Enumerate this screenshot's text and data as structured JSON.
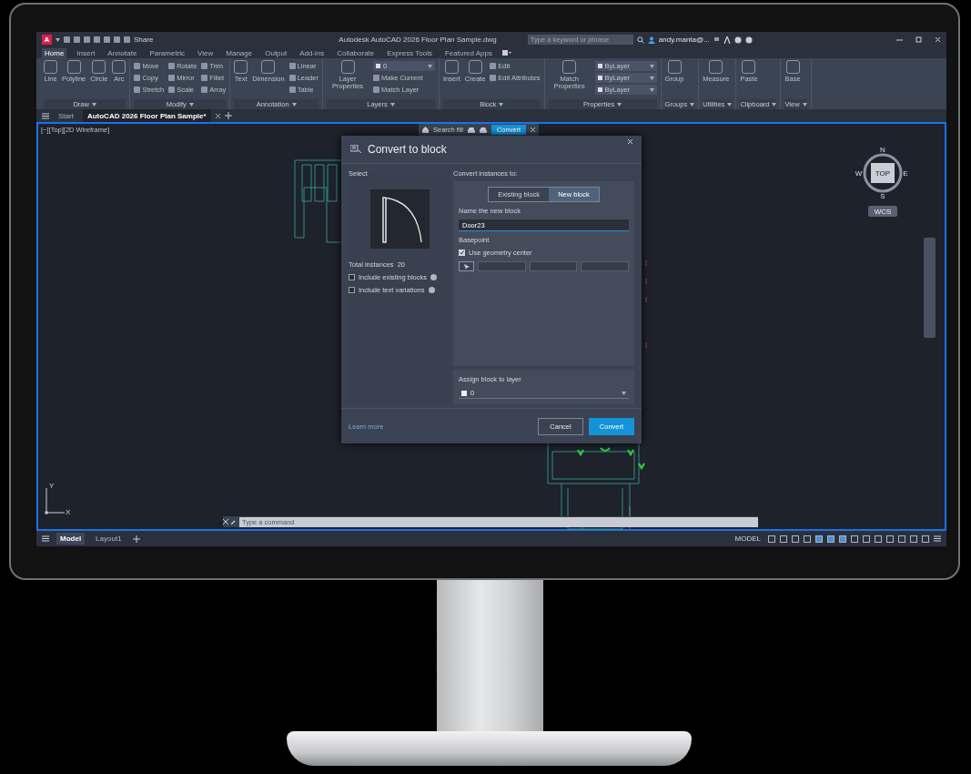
{
  "title_bar": {
    "app_logo": "A",
    "share": "Share",
    "title": "Autodesk AutoCAD 2026  Floor Plan Sample.dwg",
    "search": {
      "placeholder": "Type a keyword or phrase"
    },
    "user": "andy.manta@..."
  },
  "ribbon": {
    "tabs": [
      {
        "label": "Home",
        "selected": true
      },
      {
        "label": "Insert",
        "selected": false
      },
      {
        "label": "Annotate",
        "selected": false
      },
      {
        "label": "Parametric",
        "selected": false
      },
      {
        "label": "View",
        "selected": false
      },
      {
        "label": "Manage",
        "selected": false
      },
      {
        "label": "Output",
        "selected": false
      },
      {
        "label": "Add-ins",
        "selected": false
      },
      {
        "label": "Collaborate",
        "selected": false
      },
      {
        "label": "Express Tools",
        "selected": false
      },
      {
        "label": "Featured Apps",
        "selected": false
      }
    ],
    "panels": [
      {
        "title": "Draw",
        "tools": [
          {
            "kind": "large",
            "label": "Line"
          },
          {
            "kind": "large",
            "label": "Polyline"
          },
          {
            "kind": "large",
            "label": "Circle"
          },
          {
            "kind": "large",
            "label": "Arc"
          }
        ]
      },
      {
        "title": "Modify",
        "tools": [
          {
            "kind": "small",
            "label": "Move"
          },
          {
            "kind": "small",
            "label": "Copy"
          },
          {
            "kind": "small",
            "label": "Stretch"
          },
          {
            "kind": "small",
            "label": "Rotate"
          },
          {
            "kind": "small",
            "label": "Mirror"
          },
          {
            "kind": "small",
            "label": "Scale"
          },
          {
            "kind": "small",
            "label": "Trim"
          },
          {
            "kind": "small",
            "label": "Fillet"
          },
          {
            "kind": "small",
            "label": "Array"
          }
        ]
      },
      {
        "title": "Annotation",
        "tools": [
          {
            "kind": "large",
            "label": "Text"
          },
          {
            "kind": "large",
            "label": "Dimension"
          },
          {
            "kind": "small",
            "label": "Linear"
          },
          {
            "kind": "small",
            "label": "Leader"
          },
          {
            "kind": "small",
            "label": "Table"
          }
        ]
      },
      {
        "title": "Layers",
        "tools": [
          {
            "kind": "large",
            "label": "Layer Properties"
          },
          {
            "kind": "dropdown",
            "label": "0"
          },
          {
            "kind": "small",
            "label": "Make Current"
          },
          {
            "kind": "small",
            "label": "Match Layer"
          }
        ]
      },
      {
        "title": "Block",
        "tools": [
          {
            "kind": "large",
            "label": "Insert"
          },
          {
            "kind": "large",
            "label": "Create"
          },
          {
            "kind": "small",
            "label": "Edit"
          },
          {
            "kind": "small",
            "label": "Edit Attributes"
          }
        ]
      },
      {
        "title": "Properties",
        "tools": [
          {
            "kind": "large",
            "label": "Match Properties"
          },
          {
            "kind": "dropdown",
            "label": "ByLayer"
          },
          {
            "kind": "dropdown",
            "label": "ByLayer"
          },
          {
            "kind": "dropdown",
            "label": "ByLayer"
          }
        ]
      },
      {
        "title": "Groups",
        "tools": [
          {
            "kind": "large",
            "label": "Group"
          }
        ]
      },
      {
        "title": "Utilities",
        "tools": [
          {
            "kind": "large",
            "label": "Measure"
          }
        ]
      },
      {
        "title": "Clipboard",
        "tools": [
          {
            "kind": "large",
            "label": "Paste"
          }
        ]
      },
      {
        "title": "View",
        "tools": [
          {
            "kind": "large",
            "label": "Base"
          }
        ]
      }
    ]
  },
  "file_tabs": [
    {
      "label": "Start",
      "selected": false
    },
    {
      "label": "AutoCAD 2026  Floor Plan Sample*",
      "selected": true
    }
  ],
  "viewport": {
    "label": "[−][Top][2D Wireframe]",
    "floating_toolbar": {
      "search": "Search fill",
      "button": "Convert"
    },
    "viewcube": {
      "north": "N",
      "south": "S",
      "east": "E",
      "west": "W",
      "top": "TOP",
      "wcs": "WCS"
    },
    "ucs": {
      "x": "X",
      "y": "Y"
    },
    "command_line": {
      "placeholder": "Type a command"
    }
  },
  "dialog": {
    "title": "Convert to block",
    "select": {
      "heading": "Select",
      "total_label": "Total instances",
      "total": "20",
      "options": [
        {
          "label": "Include existing blocks",
          "checked": false
        },
        {
          "label": "Include text variations",
          "checked": false
        }
      ]
    },
    "convert": {
      "heading": "Convert instances to:",
      "modes": [
        {
          "label": "Existing block",
          "selected": false
        },
        {
          "label": "New block",
          "selected": true
        }
      ],
      "name_label": "Name the new block",
      "name_value": "Door23",
      "basepoint_label": "Basepoint",
      "geometry_center": {
        "label": "Use geometry center",
        "checked": true
      },
      "layer_label": "Assign block to layer",
      "layer_value": "0"
    },
    "learn_more": "Learn more",
    "buttons": [
      {
        "label": "Cancel",
        "kind": "secondary"
      },
      {
        "label": "Convert",
        "kind": "primary"
      }
    ]
  },
  "status_bar": {
    "layouts": [
      {
        "label": "Model",
        "selected": true
      },
      {
        "label": "Layout1",
        "selected": false
      }
    ],
    "space": "MODEL"
  }
}
